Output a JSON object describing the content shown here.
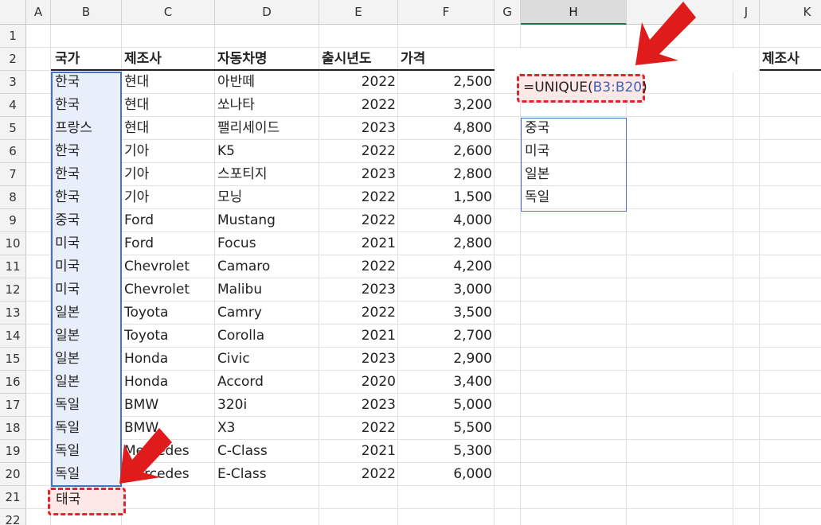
{
  "columns": [
    "A",
    "B",
    "C",
    "D",
    "E",
    "F",
    "G",
    "H",
    "I",
    "J",
    "K"
  ],
  "rows": [
    "1",
    "2",
    "3",
    "4",
    "5",
    "6",
    "7",
    "8",
    "9",
    "10",
    "11",
    "12",
    "13",
    "14",
    "15",
    "16",
    "17",
    "18",
    "19",
    "20",
    "21",
    "22"
  ],
  "headers": {
    "country": "국가",
    "maker": "제조사",
    "model": "자동차명",
    "year": "출시년도",
    "price": "가격",
    "k_header": "제조사"
  },
  "table": [
    [
      "한국",
      "현대",
      "아반떼",
      "2022",
      "2,500"
    ],
    [
      "한국",
      "현대",
      "쏘나타",
      "2022",
      "3,200"
    ],
    [
      "프랑스",
      "현대",
      "팰리세이드",
      "2023",
      "4,800"
    ],
    [
      "한국",
      "기아",
      "K5",
      "2022",
      "2,600"
    ],
    [
      "한국",
      "기아",
      "스포티지",
      "2023",
      "2,800"
    ],
    [
      "한국",
      "기아",
      "모닝",
      "2022",
      "1,500"
    ],
    [
      "중국",
      "Ford",
      "Mustang",
      "2022",
      "4,000"
    ],
    [
      "미국",
      "Ford",
      "Focus",
      "2021",
      "2,800"
    ],
    [
      "미국",
      "Chevrolet",
      "Camaro",
      "2022",
      "4,200"
    ],
    [
      "미국",
      "Chevrolet",
      "Malibu",
      "2023",
      "3,000"
    ],
    [
      "일본",
      "Toyota",
      "Camry",
      "2022",
      "3,500"
    ],
    [
      "일본",
      "Toyota",
      "Corolla",
      "2021",
      "2,700"
    ],
    [
      "일본",
      "Honda",
      "Civic",
      "2023",
      "2,900"
    ],
    [
      "일본",
      "Honda",
      "Accord",
      "2020",
      "3,400"
    ],
    [
      "독일",
      "BMW",
      "320i",
      "2023",
      "5,000"
    ],
    [
      "독일",
      "BMW",
      "X3",
      "2022",
      "5,500"
    ],
    [
      "독일",
      "Mercedes",
      "C-Class",
      "2021",
      "5,300"
    ],
    [
      "독일",
      "Mercedes",
      "E-Class",
      "2022",
      "6,000"
    ]
  ],
  "b21_value": "태국",
  "formula": {
    "prefix": "=UNIQUE(",
    "range": "B3:B20",
    "suffix": ")"
  },
  "spill_results": [
    "중국",
    "미국",
    "일본",
    "독일"
  ],
  "colors": {
    "highlight": "#e0262b",
    "selection": "#4a72c4",
    "arrow": "#e01b1b"
  }
}
